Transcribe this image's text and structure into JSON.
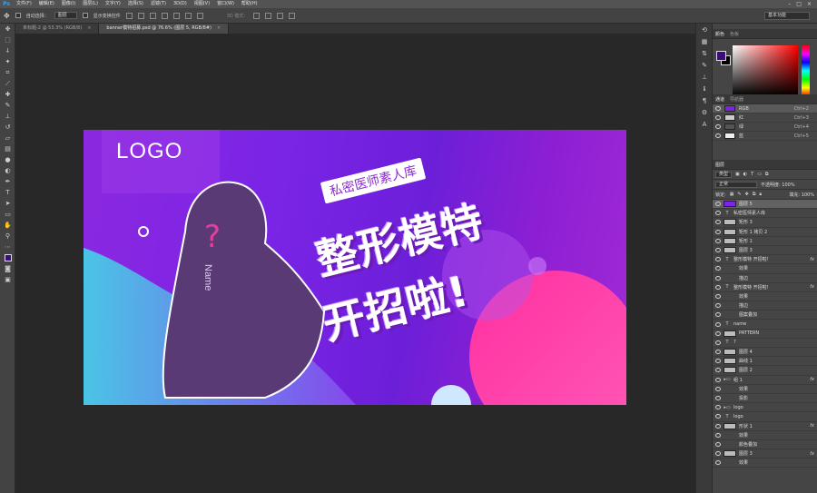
{
  "menubar": {
    "app": "Ps",
    "items": [
      "文件(F)",
      "编辑(E)",
      "图像(I)",
      "图层(L)",
      "文字(Y)",
      "选择(S)",
      "滤镜(T)",
      "3D(D)",
      "视图(V)",
      "窗口(W)",
      "帮助(H)"
    ]
  },
  "options": {
    "auto_select": "自动选择：",
    "group_value": "图层",
    "show_transform": "显示变换控件",
    "mode_3d": "3D 模式：",
    "workspace": "基本功能"
  },
  "tabs": [
    {
      "label": "未标题-2 @ 53.3% (RGB/8)",
      "active": false
    },
    {
      "label": "banner模特招募.psd @ 76.6% (图层 5, RGB/8#)",
      "active": true
    }
  ],
  "banner": {
    "logo": "LOGO",
    "question": "?",
    "name": "Name",
    "tag": "私密医师素人库",
    "line1": "整形模特",
    "line2": "开招啦!"
  },
  "panels": {
    "color_tabs": [
      "颜色",
      "色板"
    ],
    "channel_tabs": [
      "通道",
      "导航器"
    ],
    "channels": [
      {
        "name": "RGB",
        "shortcut": "Ctrl+2"
      },
      {
        "name": "红",
        "shortcut": "Ctrl+3"
      },
      {
        "name": "绿",
        "shortcut": "Ctrl+4"
      },
      {
        "name": "蓝",
        "shortcut": "Ctrl+5"
      }
    ],
    "layers_title": "图层",
    "filter": "类型",
    "blend": "正常",
    "opacity": "不透明度: 100%",
    "lock": "锁定:",
    "fill": "填充: 100%",
    "layers": [
      {
        "type": "img",
        "name": "图层 5",
        "sel": true
      },
      {
        "type": "T",
        "name": "私密医师素人库"
      },
      {
        "type": "img",
        "name": "矩形 3"
      },
      {
        "type": "img",
        "name": "矩形 1 拷贝 2"
      },
      {
        "type": "img",
        "name": "矩形 1"
      },
      {
        "type": "img",
        "name": "图层 3"
      },
      {
        "type": "T",
        "name": "整形模特 开招啦!",
        "fx": "fx"
      },
      {
        "type": "sub",
        "name": "效果"
      },
      {
        "type": "sub",
        "name": "描边"
      },
      {
        "type": "T",
        "name": "整形模特 开招啦!",
        "fx": "fx"
      },
      {
        "type": "sub",
        "name": "效果"
      },
      {
        "type": "sub",
        "name": "描边"
      },
      {
        "type": "sub",
        "name": "图案叠加"
      },
      {
        "type": "T",
        "name": "name"
      },
      {
        "type": "img",
        "name": "PATTERN"
      },
      {
        "type": "T",
        "name": "?"
      },
      {
        "type": "img",
        "name": "图层 4"
      },
      {
        "type": "img",
        "name": "曲线 1"
      },
      {
        "type": "img",
        "name": "图层 2"
      },
      {
        "type": "folder",
        "name": "组 1",
        "fx": "fx"
      },
      {
        "type": "sub",
        "name": "效果"
      },
      {
        "type": "sub",
        "name": "投影"
      },
      {
        "type": "folder",
        "name": "logo"
      },
      {
        "type": "T",
        "name": "logo"
      },
      {
        "type": "img",
        "name": "形状 1",
        "fx": "fx"
      },
      {
        "type": "sub",
        "name": "效果"
      },
      {
        "type": "sub",
        "name": "颜色叠加"
      },
      {
        "type": "img",
        "name": "图层 3",
        "fx": "fx"
      },
      {
        "type": "sub",
        "name": "效果"
      }
    ]
  },
  "colors": {
    "accent_purple": "#7a24e6",
    "accent_pink": "#e33e9c"
  }
}
